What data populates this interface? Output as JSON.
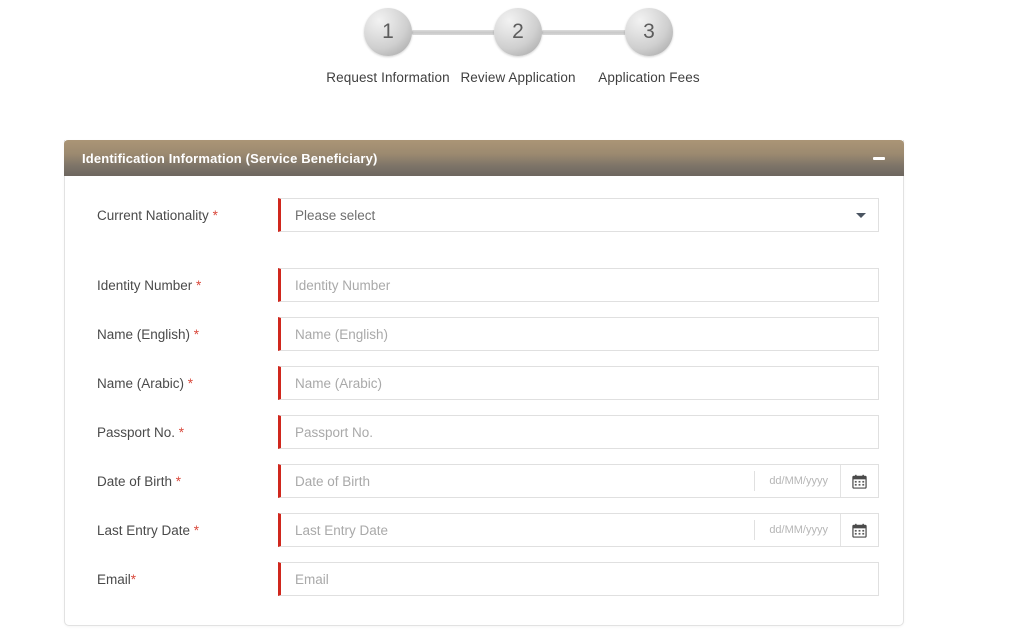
{
  "stepper": {
    "steps": [
      {
        "number": "1",
        "label": "Request Information"
      },
      {
        "number": "2",
        "label": "Review Application"
      },
      {
        "number": "3",
        "label": "Application Fees"
      }
    ]
  },
  "panel": {
    "title": "Identification Information (Service Beneficiary)",
    "collapse_icon": "minus-icon"
  },
  "form": {
    "fields": [
      {
        "label": "Current Nationality ",
        "required_mark": "*",
        "type": "select",
        "value": "Please select",
        "icon": "chevron-down-icon"
      },
      {
        "label": "Identity Number ",
        "required_mark": "*",
        "type": "text",
        "placeholder": "Identity Number"
      },
      {
        "label": "Name (English) ",
        "required_mark": "*",
        "type": "text",
        "placeholder": "Name (English)"
      },
      {
        "label": "Name (Arabic) ",
        "required_mark": "*",
        "type": "text",
        "placeholder": "Name (Arabic)"
      },
      {
        "label": "Passport No. ",
        "required_mark": "*",
        "type": "text",
        "placeholder": "Passport No."
      },
      {
        "label": "Date of Birth ",
        "required_mark": "*",
        "type": "date",
        "placeholder": "Date of Birth",
        "format_hint": "dd/MM/yyyy",
        "icon": "calendar-icon"
      },
      {
        "label": "Last Entry Date ",
        "required_mark": "*",
        "type": "date",
        "placeholder": "Last Entry Date",
        "format_hint": "dd/MM/yyyy",
        "icon": "calendar-icon"
      },
      {
        "label": "Email",
        "required_mark": "*",
        "type": "text",
        "placeholder": "Email"
      }
    ]
  },
  "colors": {
    "panel_header_top": "#ab9576",
    "panel_header_bottom": "#6d665f",
    "required_bar": "#d0271d",
    "required_star": "#d9483b"
  }
}
